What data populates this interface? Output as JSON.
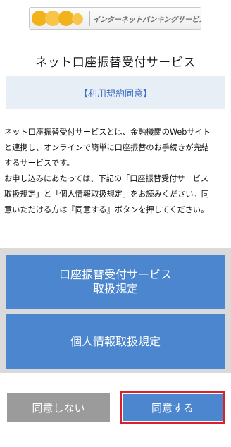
{
  "header": {
    "logo_text": "インターネットバンキングサービス"
  },
  "page": {
    "title": "ネット口座振替受付サービス",
    "consent_label": "【利用規約同意】"
  },
  "description": {
    "lines": [
      "ネット口座振替受付サービスとは、金融機関のWebサイト",
      "と連携し、オンラインで簡単に口座振替のお手続きが完結",
      "するサービスです。",
      "お申し込みにあたっては、下記の「口座振替受付サービス",
      "取扱規定」と「個人情報取扱規定」をお読みください。同",
      "意いただける方は『同意する』ボタンを押してください。"
    ]
  },
  "documents": {
    "terms_button": {
      "line1": "口座振替受付サービス",
      "line2": "取扱規定"
    },
    "privacy_button": {
      "label": "個人情報取扱規定"
    }
  },
  "actions": {
    "disagree_label": "同意しない",
    "agree_label": "同意する"
  },
  "colors": {
    "primary_blue": "#4b86cf",
    "consent_text": "#3b6fc2",
    "consent_bg": "#e7eef6",
    "disabled_gray": "#9b9b9b",
    "highlight_red": "#dd1f2a",
    "logo_yellow": "#f2b21b"
  }
}
